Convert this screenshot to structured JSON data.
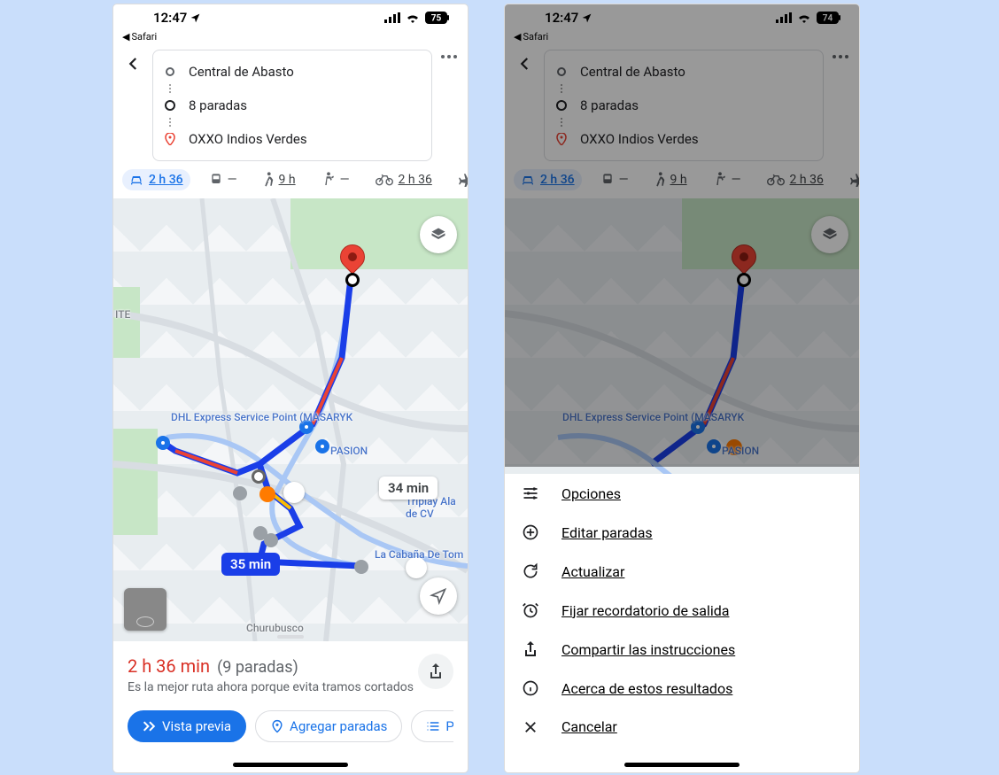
{
  "status": {
    "time": "12:47",
    "battery_left": "75",
    "battery_right": "74",
    "back_app": "Safari"
  },
  "route": {
    "origin": "Central de Abasto",
    "stops": "8 paradas",
    "destination": "OXXO Indios Verdes"
  },
  "modes": {
    "drive": "2 h 36",
    "transit": "—",
    "walk": "9 h",
    "accessible": "—",
    "bike": "2 h 36"
  },
  "map": {
    "label_dhl": "DHL Express Service Point (MASARYK",
    "label_pasion": "PASION",
    "label_triplay": "Triplay Ala de CV",
    "label_cabana": "La Cabaña De Tom",
    "label_churubusco": "Churubusco",
    "label_ite": "ITE",
    "bubble_primary": "35 min",
    "bubble_alt": "34 min"
  },
  "sheet": {
    "title": "2 h 36 min",
    "stops": "(9 paradas)",
    "desc": "Es la mejor ruta ahora porque evita tramos cortados",
    "btn_preview": "Vista previa",
    "btn_addstops": "Agregar paradas",
    "btn_steps": "Pasos"
  },
  "menu": {
    "options": "Opciones",
    "edit_stops": "Editar paradas",
    "refresh": "Actualizar",
    "reminder": "Fijar recordatorio de salida",
    "share": "Compartir las instrucciones",
    "about": "Acerca de estos resultados",
    "cancel": "Cancelar"
  }
}
